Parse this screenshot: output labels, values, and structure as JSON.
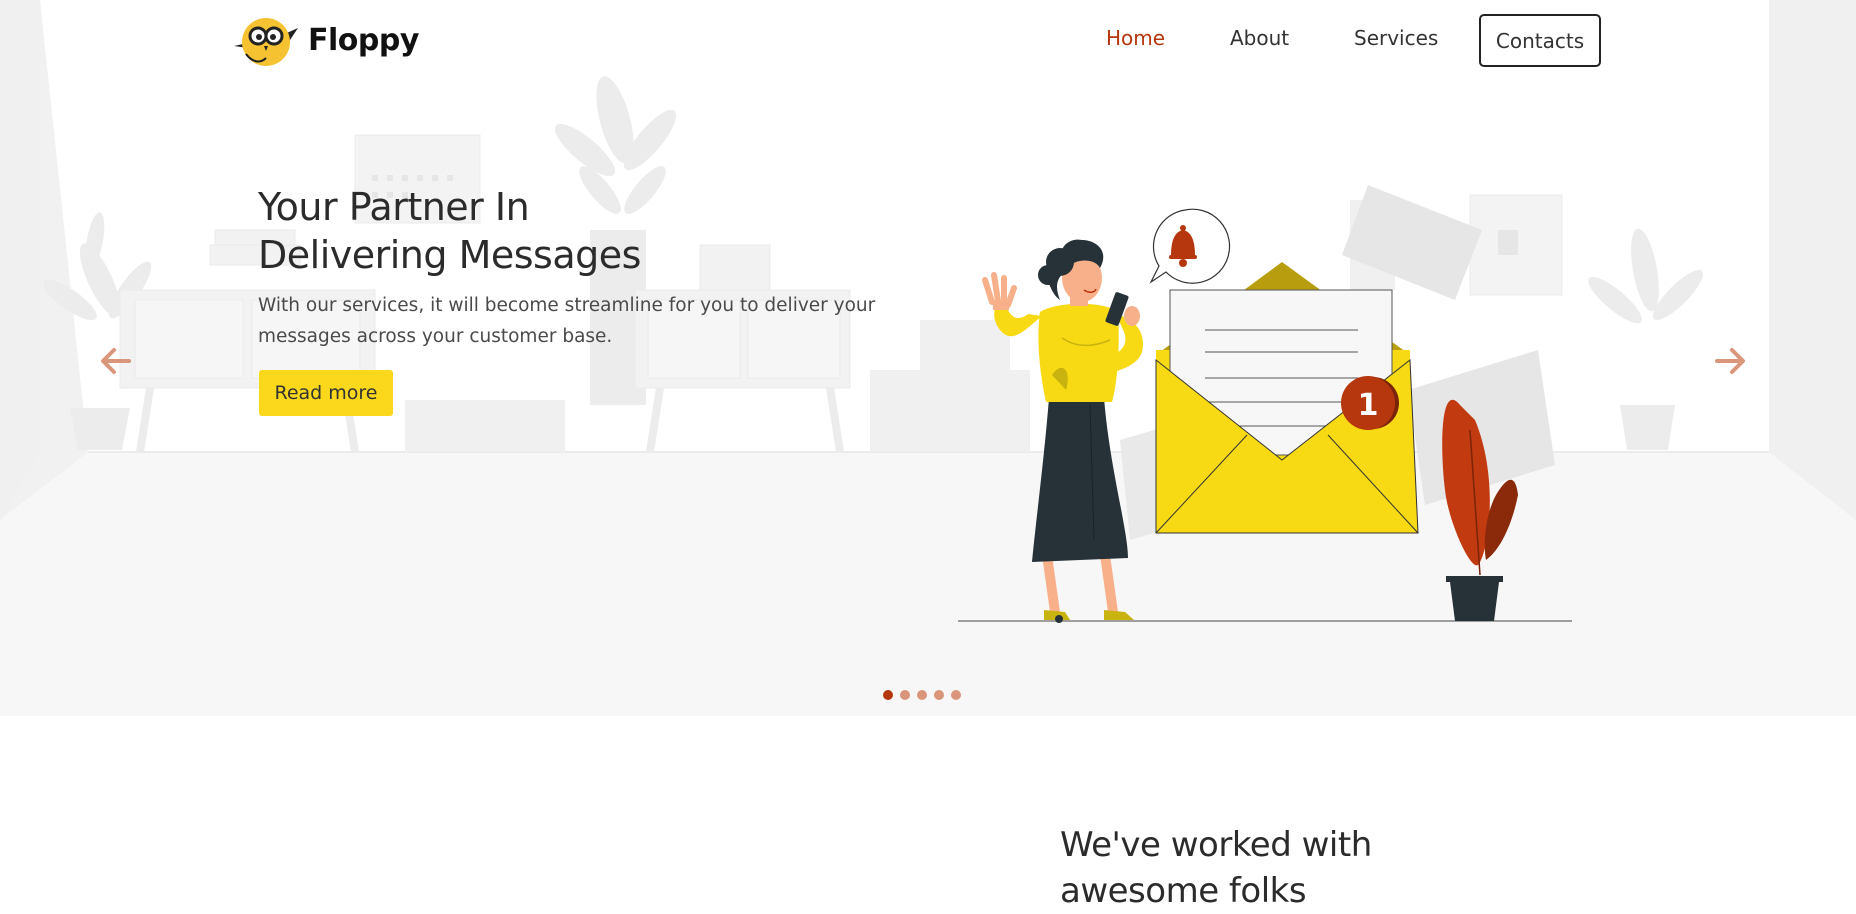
{
  "brand": {
    "name": "Floppy"
  },
  "nav": {
    "links": [
      {
        "label": "Home",
        "active": true
      },
      {
        "label": "About",
        "active": false
      },
      {
        "label": "Services",
        "active": false
      }
    ],
    "contacts_label": "Contacts"
  },
  "hero": {
    "title": "Your Partner In Delivering Messages",
    "text": "With our services, it will become streamline for you to deliver your messages across your customer base.",
    "cta_label": "Read more",
    "notification_count": "1",
    "slides": {
      "count": 5,
      "active_index": 0
    }
  },
  "section": {
    "title": "We've worked with awesome folks"
  },
  "colors": {
    "accent": "#b6360e",
    "yellow": "#fbd81b",
    "dark": "#263238",
    "arrow": "#d9967b"
  },
  "icons": {
    "prev": "arrow-left-icon",
    "next": "arrow-right-icon",
    "bell": "bell-icon"
  }
}
